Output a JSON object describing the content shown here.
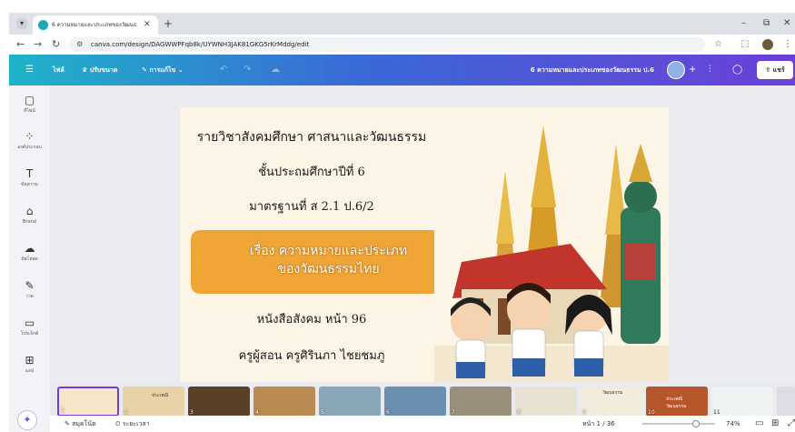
{
  "browser": {
    "tab_title": "6 ความหมายและประเภทของวัฒนธรร",
    "tab_close": "✕",
    "new_tab": "+",
    "url": "canva.com/design/DAGWWPFqb8k/UYWNH3JAK81GKG5rKrMddg/edit",
    "window_min": "–",
    "window_restore": "⧉",
    "window_close": "✕"
  },
  "canva_toolbar": {
    "menu_icon": "☰",
    "file_label": "ไฟล์",
    "resize_label": "ปรับขนาด",
    "edit_label": "การแก้ไข",
    "doc_title": "6 ความหมายและประเภทของวัฒนธรรม ป.6",
    "share_label": "แชร์",
    "add_label": "+"
  },
  "sidebar": {
    "items": [
      {
        "label": "ดีไซน์",
        "icon": "▢"
      },
      {
        "label": "องค์ประกอบ",
        "icon": "⁘"
      },
      {
        "label": "ข้อความ",
        "icon": "T"
      },
      {
        "label": "Brand",
        "icon": "⌂"
      },
      {
        "label": "อัพโหลด",
        "icon": "☁"
      },
      {
        "label": "วาด",
        "icon": "✎"
      },
      {
        "label": "โปรเจ็กต์",
        "icon": "▭"
      },
      {
        "label": "แอป",
        "icon": "⊞"
      }
    ],
    "magic_icon": "✦"
  },
  "slide": {
    "line1": "รายวิชาสังคมศึกษา ศาสนาและวัฒนธรรม",
    "line2": "ชั้นประถมศึกษาปีที่ 6",
    "line3": "มาตรฐานที่ ส 2.1 ป.6/2",
    "banner_line1": "เรื่อง ความหมายและประเภท",
    "banner_line2": "ของวัฒนธรรมไทย",
    "line4": "หนังสือสังคม หน้า 96",
    "line5": "ครูผู้สอน ครูศิรินภา  ไชยชมภู"
  },
  "filmstrip": {
    "pages": [
      "1",
      "2",
      "3",
      "4",
      "5",
      "6",
      "7",
      "8",
      "9",
      "10",
      "11"
    ],
    "thumb_colors": [
      "#f6e6c8",
      "#cfa873",
      "#5a4028",
      "#b98a52",
      "#8aa7b8",
      "#6b8fb0",
      "#9a8f7a",
      "#e8e2d2",
      "#f2ecdc",
      "#b5572a",
      "#eef2f0"
    ],
    "thumb2_caption": "ประเพณี",
    "thumb9_caption": "วัฒนธรรม",
    "thumb10_caption": "ประเพณี วัฒนธรรม"
  },
  "statusbar": {
    "notes_label": "สมุดโน้ต",
    "timer_label": "ระยะเวลา",
    "page_label": "หน้า 1 / 36",
    "zoom_label": "74%",
    "zoom_value": 0.74
  }
}
